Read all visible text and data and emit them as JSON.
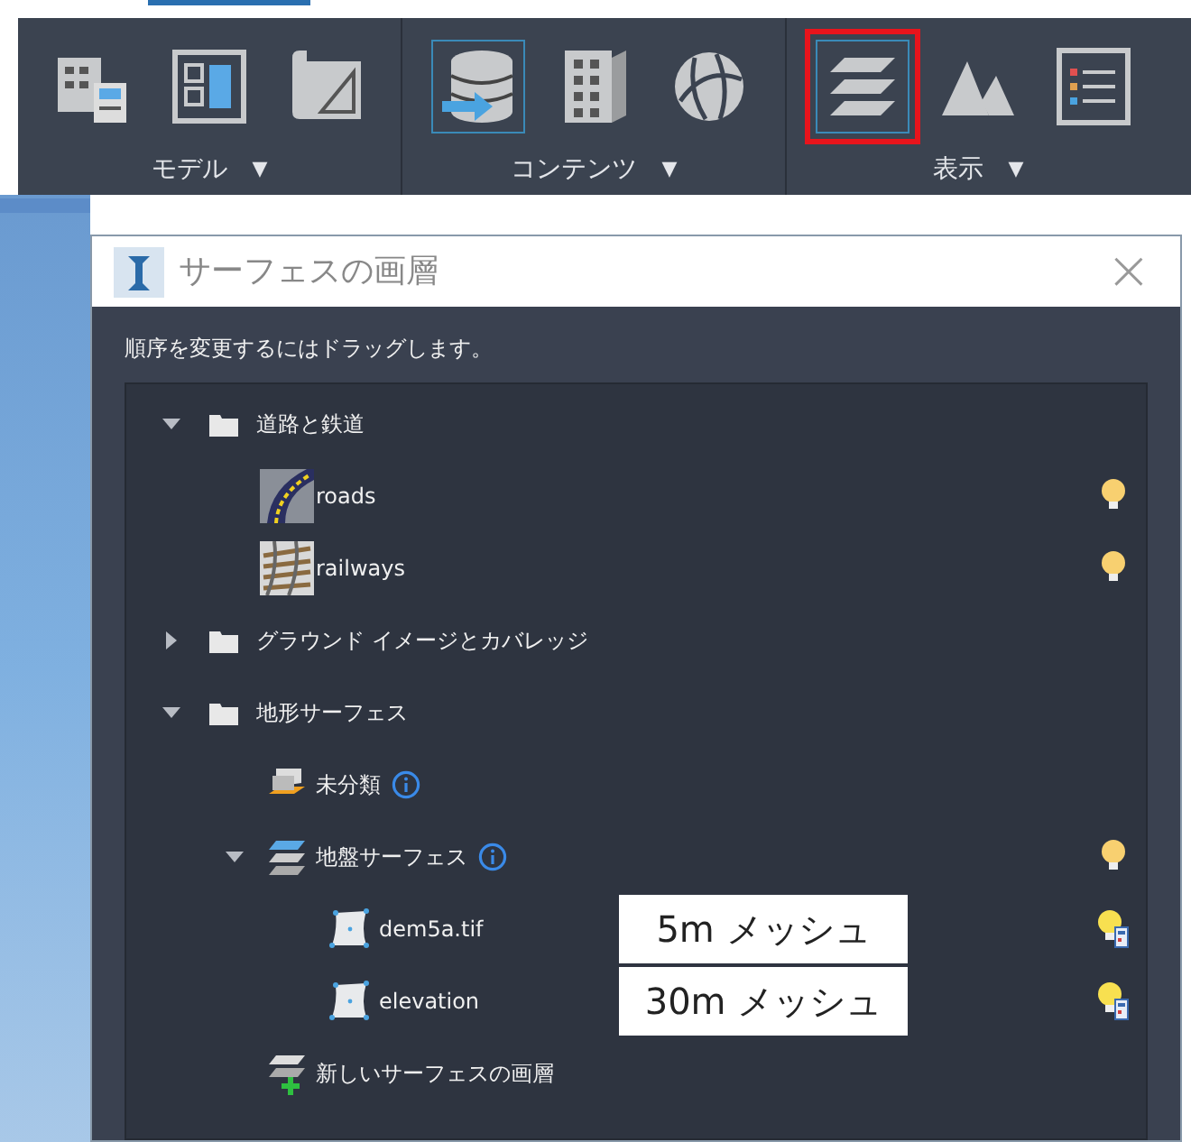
{
  "ribbon": {
    "groups": [
      {
        "label": "モデル",
        "dropdown": "▼",
        "tools": [
          {
            "kind": "building",
            "selected": false
          },
          {
            "kind": "panel",
            "selected": false
          },
          {
            "kind": "sketch",
            "selected": false
          }
        ]
      },
      {
        "label": "コンテンツ",
        "dropdown": "▼",
        "tools": [
          {
            "kind": "database",
            "selected": true
          },
          {
            "kind": "city",
            "selected": false
          },
          {
            "kind": "globe",
            "selected": false
          }
        ]
      },
      {
        "label": "表示",
        "dropdown": "▼",
        "tools": [
          {
            "kind": "layers",
            "selected": true,
            "highlighted": true
          },
          {
            "kind": "mountain",
            "selected": false
          },
          {
            "kind": "list",
            "selected": false
          }
        ]
      }
    ]
  },
  "dialog": {
    "title": "サーフェスの画層",
    "close": "×",
    "instruction": "順序を変更するにはドラッグします。",
    "tree": [
      {
        "kind": "folder",
        "label": "道路と鉄道",
        "expanded": true,
        "children": [
          {
            "kind": "road",
            "label": "roads",
            "lamp": true,
            "linked": false
          },
          {
            "kind": "rail",
            "label": "railways",
            "lamp": true,
            "linked": false
          }
        ]
      },
      {
        "kind": "folder",
        "label": "グラウンド イメージとカバレッジ",
        "expanded": false
      },
      {
        "kind": "folder",
        "label": "地形サーフェス",
        "expanded": true,
        "children": [
          {
            "kind": "unclassified",
            "label": "未分類",
            "info": true
          },
          {
            "kind": "surface",
            "label": "地盤サーフェス",
            "info": true,
            "expanded": true,
            "lamp": true,
            "linked": false,
            "children": [
              {
                "kind": "raster",
                "label": "dem5a.tif",
                "lamp": true,
                "linked": true,
                "callout": "5m メッシュ"
              },
              {
                "kind": "raster",
                "label": "elevation",
                "lamp": true,
                "linked": true,
                "callout": "30m メッシュ"
              }
            ]
          },
          {
            "kind": "new",
            "label": "新しいサーフェスの画層"
          }
        ]
      }
    ]
  }
}
